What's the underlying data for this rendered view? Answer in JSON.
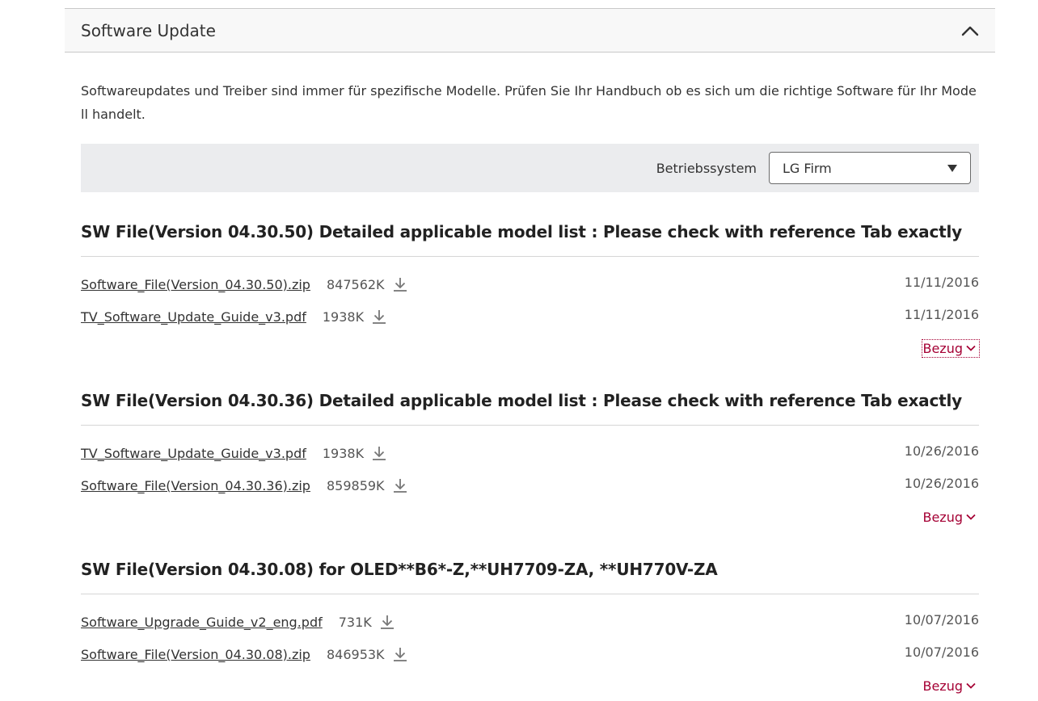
{
  "section": {
    "title": "Software Update",
    "intro": "Softwareupdates und Treiber sind immer für spezifische Modelle. Prüfen Sie Ihr Handbuch ob es sich um die richtige Software für Ihr Modell handelt.",
    "filter_label": "Betriebssystem",
    "filter_value": "LG Firm"
  },
  "software": [
    {
      "title": "SW File(Version 04.30.50) Detailed applicable model list : Please check with reference Tab exactly",
      "files": [
        {
          "name": "Software_File(Version_04.30.50).zip",
          "size": "847562K",
          "date": "11/11/2016"
        },
        {
          "name": "TV_Software_Update_Guide_v3.pdf",
          "size": "1938K",
          "date": "11/11/2016"
        }
      ],
      "reference_label": "Bezug"
    },
    {
      "title": "SW File(Version 04.30.36) Detailed applicable model list : Please check with reference Tab exactly",
      "files": [
        {
          "name": "TV_Software_Update_Guide_v3.pdf",
          "size": "1938K",
          "date": "10/26/2016"
        },
        {
          "name": "Software_File(Version_04.30.36).zip",
          "size": "859859K",
          "date": "10/26/2016"
        }
      ],
      "reference_label": "Bezug"
    },
    {
      "title": "SW File(Version 04.30.08) for OLED**B6*-Z,**UH7709-ZA, **UH770V-ZA",
      "files": [
        {
          "name": "Software_Upgrade_Guide_v2_eng.pdf",
          "size": "731K",
          "date": "10/07/2016"
        },
        {
          "name": "Software_File(Version_04.30.08).zip",
          "size": "846953K",
          "date": "10/07/2016"
        }
      ],
      "reference_label": "Bezug"
    }
  ],
  "icons": {
    "collapse": "chevron-up-icon",
    "dropdown": "caret-down-icon",
    "download": "download-icon",
    "expand": "chevron-down-icon"
  },
  "colors": {
    "accent": "#a50034",
    "header_bg": "#f8f8f8",
    "filter_bg": "#ebecee"
  }
}
